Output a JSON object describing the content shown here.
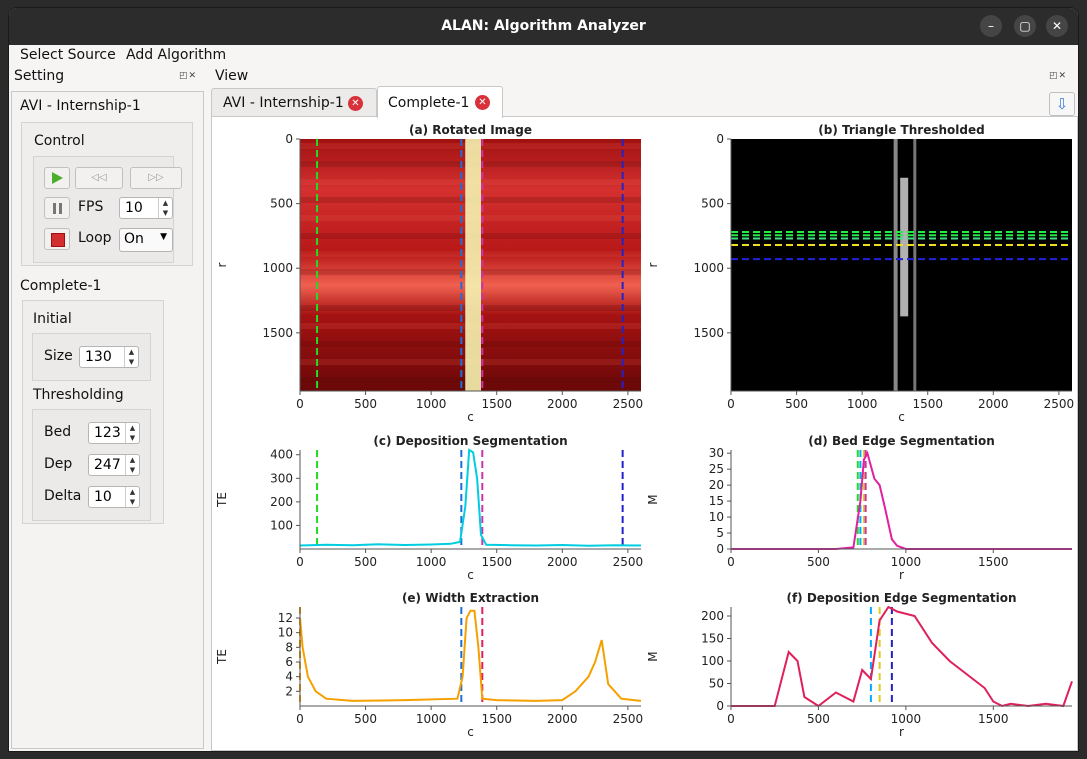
{
  "window": {
    "title": "ALAN: Algorithm Analyzer",
    "minimize_icon": "–",
    "maximize_icon": "▢",
    "close_icon": "✕"
  },
  "menu": {
    "items": [
      "Select Source",
      "Add Algorithm"
    ]
  },
  "setting_panel": {
    "title": "Setting",
    "source_title": "AVI - Internship-1",
    "control": {
      "title": "Control",
      "fps_label": "FPS",
      "fps_value": "10",
      "loop_label": "Loop",
      "loop_value": "On"
    },
    "algorithm_title": "Complete-1",
    "initial": {
      "title": "Initial",
      "size_label": "Size",
      "size_value": "130"
    },
    "thresholding": {
      "title": "Thresholding",
      "bed_label": "Bed",
      "bed_value": "123",
      "dep_label": "Dep",
      "dep_value": "247",
      "delta_label": "Delta",
      "delta_value": "10"
    }
  },
  "view_panel": {
    "title": "View",
    "tabs": [
      "AVI - Internship-1",
      "Complete-1"
    ],
    "active_tab": 1
  },
  "colors": {
    "accent": "#3b7bd4",
    "close": "#d9313a",
    "play": "#4caf2b",
    "stop": "#d32f2f"
  },
  "chart_data": [
    {
      "type": "heatmap",
      "title": "(a) Rotated Image",
      "xlabel": "c",
      "ylabel": "r",
      "xticks": [
        "0",
        "500",
        "1000",
        "1500",
        "2000",
        "2500"
      ],
      "yticks": [
        "0",
        "500",
        "1000",
        "1500"
      ],
      "xlim": [
        0,
        2600
      ],
      "ylim": [
        1950,
        0
      ],
      "vlines": [
        {
          "x": 130,
          "color": "#22dd22"
        },
        {
          "x": 1230,
          "color": "#1b6fd6"
        },
        {
          "x": 1390,
          "color": "#cc33aa"
        },
        {
          "x": 2460,
          "color": "#2222cc"
        }
      ]
    },
    {
      "type": "heatmap",
      "title": "(b) Triangle Thresholded",
      "xlabel": "c",
      "ylabel": "r",
      "xticks": [
        "0",
        "500",
        "1000",
        "1500",
        "2000",
        "2500"
      ],
      "yticks": [
        "0",
        "500",
        "1000",
        "1500"
      ],
      "xlim": [
        0,
        2600
      ],
      "ylim": [
        1950,
        0
      ],
      "hlines": [
        {
          "y": 720,
          "color": "#22ee44"
        },
        {
          "y": 745,
          "color": "#22ee44"
        },
        {
          "y": 770,
          "color": "#44dd88"
        },
        {
          "y": 820,
          "color": "#eedd22"
        },
        {
          "y": 930,
          "color": "#2222dd"
        }
      ]
    },
    {
      "type": "line",
      "title": "(c) Deposition Segmentation",
      "xlabel": "c",
      "ylabel": "TE",
      "xticks": [
        "0",
        "500",
        "1000",
        "1500",
        "2000",
        "2500"
      ],
      "yticks": [
        "100",
        "200",
        "300",
        "400"
      ],
      "xlim": [
        0,
        2600
      ],
      "ylim": [
        0,
        420
      ],
      "series": [
        {
          "x": [
            0,
            200,
            400,
            600,
            800,
            1000,
            1150,
            1220,
            1260,
            1290,
            1320,
            1350,
            1380,
            1420,
            1600,
            1800,
            2000,
            2200,
            2400,
            2600
          ],
          "y": [
            15,
            18,
            16,
            20,
            17,
            19,
            22,
            30,
            180,
            420,
            410,
            300,
            60,
            18,
            16,
            15,
            17,
            14,
            16,
            15
          ],
          "color": "#00cde0"
        }
      ],
      "vlines": [
        {
          "x": 130,
          "color": "#22dd22"
        },
        {
          "x": 1230,
          "color": "#1b6fd6"
        },
        {
          "x": 1390,
          "color": "#cc33aa"
        },
        {
          "x": 2460,
          "color": "#2222cc"
        }
      ]
    },
    {
      "type": "line",
      "title": "(d) Bed Edge Segmentation",
      "xlabel": "r",
      "ylabel": "M",
      "xticks": [
        "0",
        "500",
        "1000",
        "1500"
      ],
      "yticks": [
        "0",
        "5",
        "10",
        "15",
        "20",
        "25",
        "30"
      ],
      "xlim": [
        0,
        1950
      ],
      "ylim": [
        0,
        31
      ],
      "series": [
        {
          "x": [
            0,
            300,
            600,
            700,
            740,
            760,
            780,
            800,
            820,
            850,
            880,
            900,
            920,
            950,
            1000,
            1100,
            1400,
            1950
          ],
          "y": [
            0,
            0,
            0,
            0.5,
            15,
            28,
            30,
            26,
            22,
            20,
            13,
            8,
            3,
            1,
            0,
            0,
            0,
            0
          ],
          "color": "#e020a0"
        }
      ],
      "vlines": [
        {
          "x": 725,
          "color": "#22dd22"
        },
        {
          "x": 740,
          "color": "#00aaff"
        },
        {
          "x": 760,
          "color": "#ddcc22"
        },
        {
          "x": 770,
          "color": "#cc33aa"
        }
      ]
    },
    {
      "type": "line",
      "title": "(e) Width Extraction",
      "xlabel": "c",
      "ylabel": "TE",
      "xticks": [
        "0",
        "500",
        "1000",
        "1500",
        "2000",
        "2500"
      ],
      "yticks": [
        "2",
        "4",
        "6",
        "8",
        "10",
        "12"
      ],
      "xlim": [
        0,
        2600
      ],
      "ylim": [
        0,
        13.5
      ],
      "series": [
        {
          "x": [
            0,
            20,
            60,
            120,
            200,
            400,
            800,
            1200,
            1240,
            1270,
            1300,
            1330,
            1360,
            1390,
            1500,
            1800,
            2000,
            2100,
            2200,
            2250,
            2300,
            2350,
            2450,
            2600
          ],
          "y": [
            12,
            8,
            4,
            2,
            1,
            0.7,
            0.8,
            1,
            4,
            12,
            13,
            13,
            8,
            1,
            0.8,
            0.7,
            0.8,
            2,
            4,
            6,
            9,
            3,
            1,
            0.7
          ],
          "color": "#f5a000"
        }
      ],
      "vlines": [
        {
          "x": 0,
          "color": "#f5a000"
        },
        {
          "x": 1230,
          "color": "#1b6fd6"
        },
        {
          "x": 1390,
          "color": "#e0205a"
        }
      ]
    },
    {
      "type": "line",
      "title": "(f) Deposition Edge Segmentation",
      "xlabel": "r",
      "ylabel": "M",
      "xticks": [
        "0",
        "500",
        "1000",
        "1500"
      ],
      "yticks": [
        "0",
        "50",
        "100",
        "150",
        "200"
      ],
      "xlim": [
        0,
        1950
      ],
      "ylim": [
        0,
        220
      ],
      "series": [
        {
          "x": [
            0,
            250,
            330,
            380,
            420,
            500,
            600,
            700,
            750,
            800,
            850,
            900,
            950,
            1050,
            1150,
            1250,
            1350,
            1450,
            1500,
            1550,
            1600,
            1700,
            1800,
            1900,
            1950
          ],
          "y": [
            0,
            0,
            120,
            100,
            20,
            0,
            30,
            10,
            80,
            60,
            190,
            220,
            210,
            200,
            140,
            100,
            70,
            40,
            10,
            0,
            5,
            0,
            5,
            0,
            55
          ],
          "color": "#e0205a"
        }
      ],
      "vlines": [
        {
          "x": 800,
          "color": "#00aaff"
        },
        {
          "x": 850,
          "color": "#ddcc22"
        },
        {
          "x": 920,
          "color": "#2222cc"
        }
      ]
    }
  ]
}
